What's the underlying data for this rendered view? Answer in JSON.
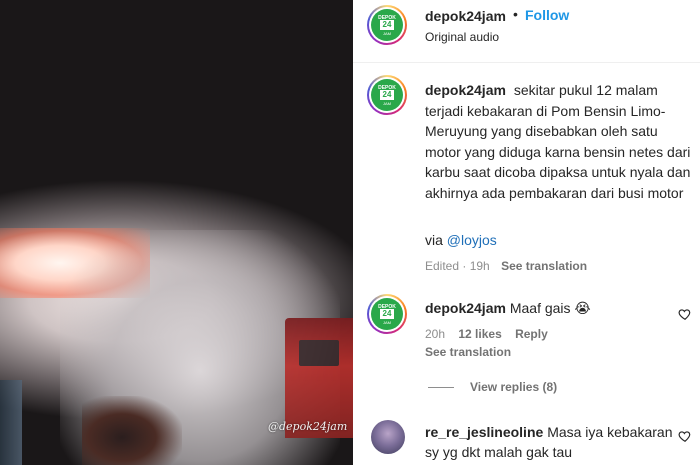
{
  "video": {
    "watermark": "@depok24jam"
  },
  "header": {
    "username": "depok24jam",
    "dot": "•",
    "follow_label": "Follow",
    "audio": "Original audio",
    "avatar_logo_top": "DEPOK",
    "avatar_logo_mid": "24",
    "avatar_logo_bottom": "JAM"
  },
  "caption": {
    "username": "depok24jam",
    "text": "sekitar pukul 12 malam terjadi kebakaran di Pom Bensin Limo-Meruyung yang disebabkan oleh satu motor yang diduga karna bensin netes dari karbu saat dicoba dipaksa untuk nyala dan akhirnya ada pembakaran dari busi motor",
    "via_prefix": "via",
    "via_handle": "@loyjos",
    "meta": "Edited · 19h",
    "see_translation": "See translation"
  },
  "comments": [
    {
      "username": "depok24jam",
      "text": "Maaf gais 😭",
      "time": "20h",
      "likes": "12 likes",
      "reply": "Reply",
      "see_translation": "See translation",
      "view_replies": "View replies (8)"
    },
    {
      "username": "re_re_jeslineoline",
      "text": "Masa iya kebakaran sy yg dkt malah gak tau"
    }
  ],
  "colors": {
    "follow": "#1f97e6",
    "link": "#1f6fb8",
    "brand_green": "#2aa84a"
  }
}
